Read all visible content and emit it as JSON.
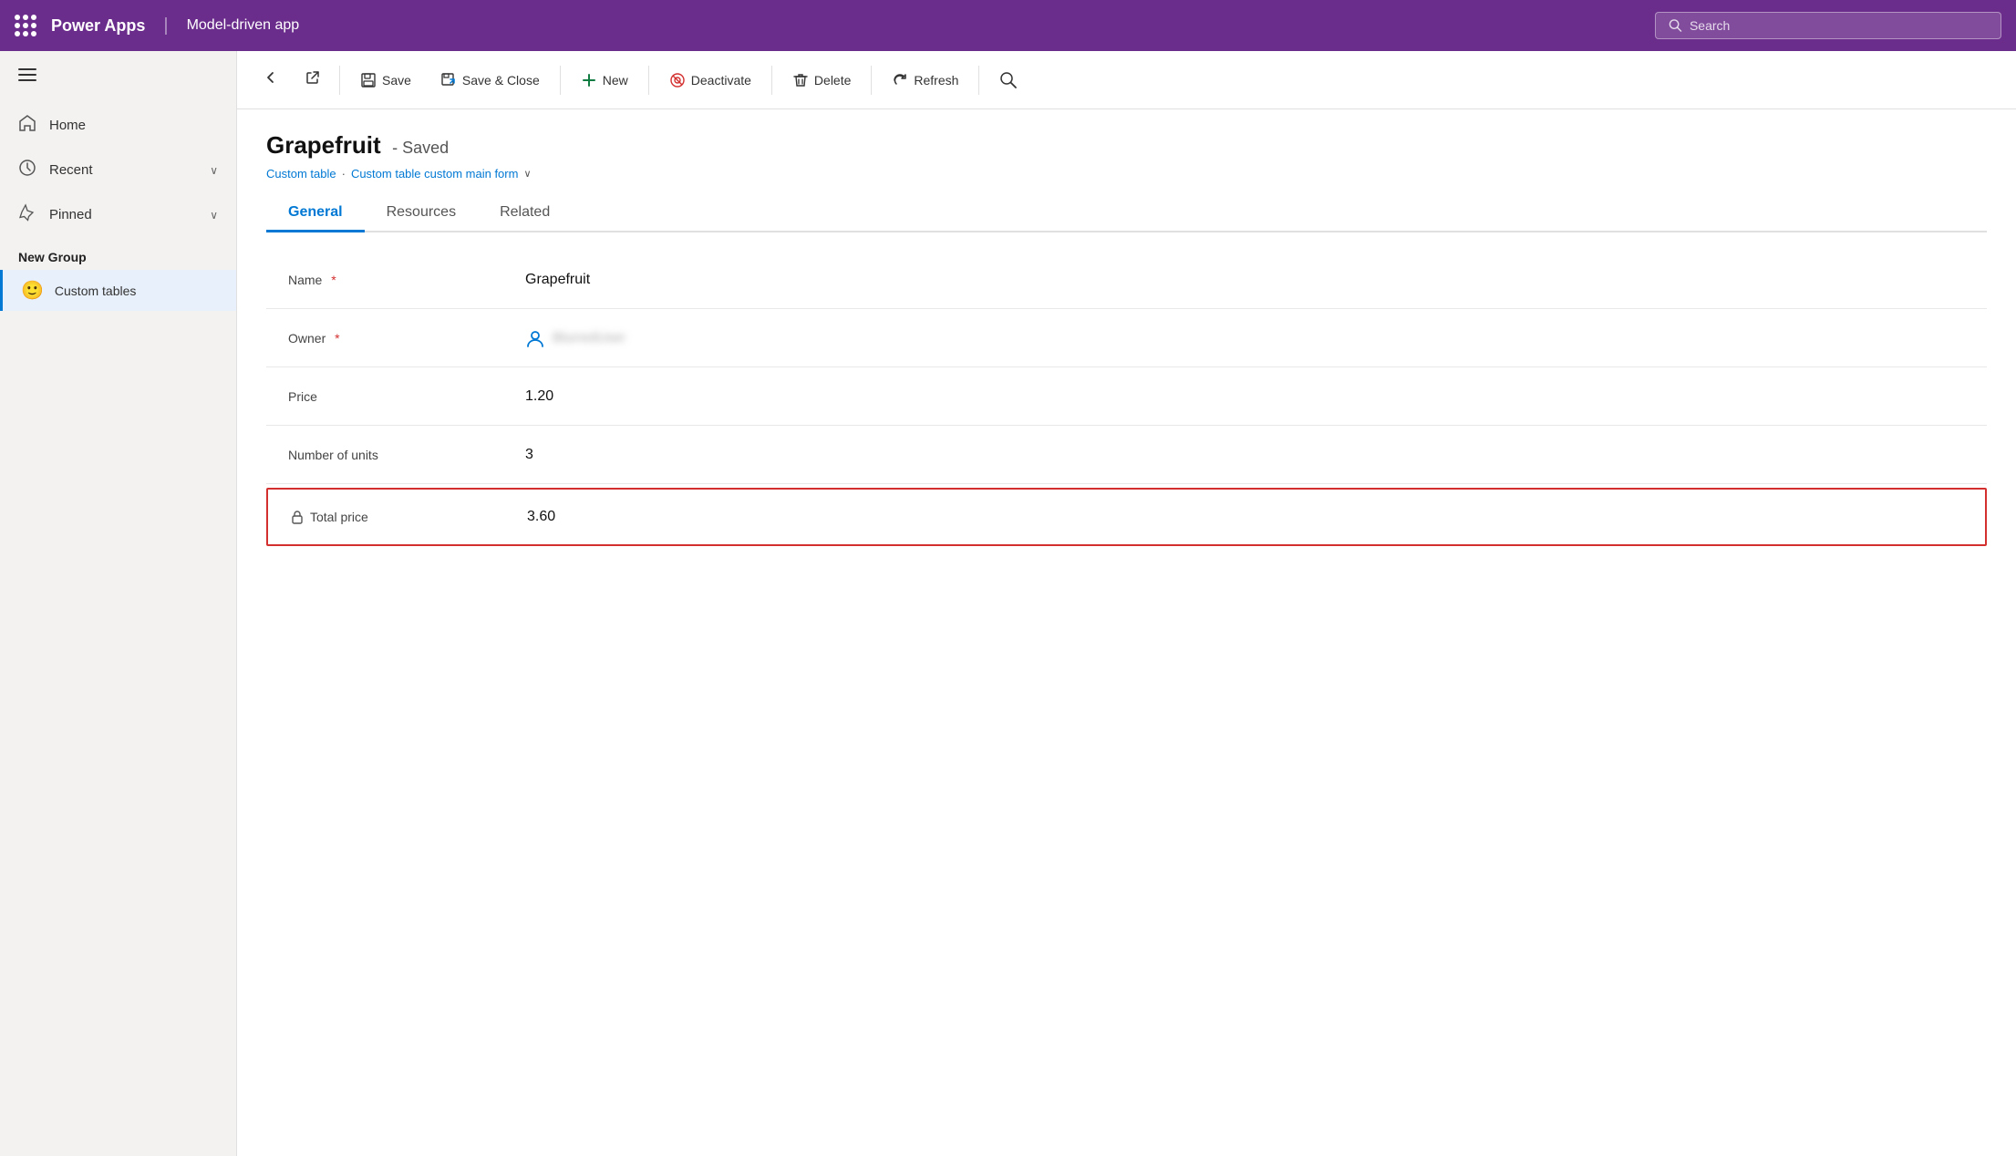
{
  "topbar": {
    "dots_label": "apps",
    "app_name": "Power Apps",
    "divider": "|",
    "app_type": "Model-driven app",
    "search_placeholder": "Search"
  },
  "sidebar": {
    "hamburger": "☰",
    "nav_items": [
      {
        "id": "home",
        "icon": "🏠",
        "label": "Home"
      },
      {
        "id": "recent",
        "icon": "🕐",
        "label": "Recent",
        "chevron": "∨"
      },
      {
        "id": "pinned",
        "icon": "✦",
        "label": "Pinned",
        "chevron": "∨"
      }
    ],
    "group_label": "New Group",
    "table_item": {
      "emoji": "🙂",
      "label": "Custom tables"
    }
  },
  "toolbar": {
    "back_label": "←",
    "ext_label": "⬡",
    "save_label": "Save",
    "save_close_label": "Save & Close",
    "new_label": "New",
    "deactivate_label": "Deactivate",
    "delete_label": "Delete",
    "refresh_label": "Refresh",
    "search_label": "🔍"
  },
  "record": {
    "title": "Grapefruit",
    "status": "- Saved",
    "breadcrumb_table": "Custom table",
    "breadcrumb_separator": "·",
    "breadcrumb_form": "Custom table custom main form",
    "breadcrumb_chevron": "∨"
  },
  "tabs": [
    {
      "id": "general",
      "label": "General",
      "active": true
    },
    {
      "id": "resources",
      "label": "Resources",
      "active": false
    },
    {
      "id": "related",
      "label": "Related",
      "active": false
    }
  ],
  "fields": [
    {
      "id": "name",
      "label": "Name",
      "required": true,
      "value": "Grapefruit",
      "type": "text"
    },
    {
      "id": "owner",
      "label": "Owner",
      "required": true,
      "value": "owner_blurred",
      "type": "owner"
    },
    {
      "id": "price",
      "label": "Price",
      "required": false,
      "value": "1.20",
      "type": "text"
    },
    {
      "id": "units",
      "label": "Number of units",
      "required": false,
      "value": "3",
      "type": "text"
    },
    {
      "id": "total_price",
      "label": "Total price",
      "required": false,
      "value": "3.60",
      "type": "locked",
      "highlighted": true
    }
  ],
  "colors": {
    "purple": "#6b2d8b",
    "blue": "#0078d4",
    "red": "#d32f2f"
  }
}
